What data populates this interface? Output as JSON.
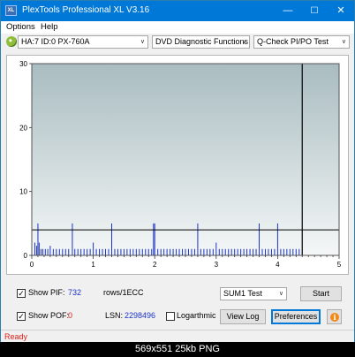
{
  "window": {
    "title": "PlexTools Professional XL V3.16",
    "logo_text": "XL",
    "minimize_glyph": "—",
    "maximize_glyph": "☐",
    "close_glyph": "✕"
  },
  "menu": {
    "options": "Options",
    "help": "Help"
  },
  "toolbar": {
    "drive": "HA:7 ID:0  PX-760A",
    "function": "DVD Diagnostic Functions",
    "test": "Q-Check PI/PO Test",
    "dropdown_glyph": "∨"
  },
  "controls": {
    "show_pif_label": "Show PIF:",
    "pif_value": "732",
    "rows_label": "rows/1ECC",
    "show_pof_label": "Show POF:",
    "pof_value": "0",
    "lsn_label": "LSN:",
    "lsn_value": "2298496",
    "logarithmic_label": "Logarthmic",
    "sum_select": "SUM1 Test",
    "start_label": "Start",
    "view_log_label": "View Log",
    "preferences_label": "Preferences",
    "info_glyph": "i",
    "check_glyph": "✓"
  },
  "status": {
    "text": "Ready"
  },
  "caption": {
    "text": "569x551  25kb  PNG"
  },
  "colors": {
    "title_bar": "#0078d7",
    "plot_top": "#a9bcc0",
    "plot_bottom": "#f4f7f7",
    "series": "#1c33c8",
    "threshold": "#000000",
    "status": "#e0201c"
  },
  "chart_data": {
    "type": "bar",
    "title": "",
    "xlabel": "",
    "ylabel": "",
    "xlim": [
      0,
      5
    ],
    "ylim": [
      0,
      30
    ],
    "x_ticks": [
      0,
      1,
      2,
      3,
      4,
      5
    ],
    "y_ticks": [
      0,
      10,
      20,
      30
    ],
    "x_minor_step": 0.1,
    "grid": false,
    "threshold_y": 4,
    "end_marker_x": 4.4,
    "series": [
      {
        "x": [
          0.05,
          0.08,
          0.1,
          0.12,
          0.15,
          0.18,
          0.22,
          0.26,
          0.3,
          0.35,
          0.4,
          0.45,
          0.5,
          0.55,
          0.6,
          0.66,
          0.7,
          0.75,
          0.8,
          0.85,
          0.9,
          0.95,
          1.0,
          1.05,
          1.1,
          1.15,
          1.2,
          1.25,
          1.3,
          1.35,
          1.4,
          1.45,
          1.5,
          1.55,
          1.6,
          1.65,
          1.7,
          1.75,
          1.8,
          1.85,
          1.9,
          1.95,
          1.98,
          2.0,
          2.05,
          2.1,
          2.15,
          2.2,
          2.25,
          2.3,
          2.35,
          2.4,
          2.45,
          2.5,
          2.55,
          2.6,
          2.65,
          2.7,
          2.75,
          2.8,
          2.85,
          2.9,
          2.95,
          3.0,
          3.05,
          3.1,
          3.15,
          3.2,
          3.25,
          3.3,
          3.35,
          3.4,
          3.45,
          3.5,
          3.55,
          3.6,
          3.65,
          3.7,
          3.75,
          3.8,
          3.85,
          3.9,
          3.95,
          4.0,
          4.05,
          4.1,
          4.15,
          4.2,
          4.25,
          4.3,
          4.35
        ],
        "values": [
          2,
          1.5,
          5,
          2,
          1,
          1,
          1,
          1,
          1.5,
          1,
          1,
          1,
          1,
          1,
          1,
          5,
          1,
          1,
          1,
          1,
          1,
          1,
          2,
          1,
          1,
          1,
          1,
          1,
          5,
          1,
          1,
          1,
          1,
          1,
          1,
          1,
          1,
          1,
          1,
          1,
          1,
          1,
          5,
          5,
          1,
          1,
          1,
          1,
          1,
          1,
          1,
          1,
          1,
          1,
          1,
          1,
          1,
          5,
          1,
          1,
          1,
          1,
          1,
          2,
          1,
          1,
          1,
          1,
          1,
          1,
          1,
          1,
          1,
          1,
          1,
          1,
          1,
          5,
          1,
          1,
          1,
          1,
          1,
          5,
          1,
          1,
          1,
          1,
          1,
          1,
          1
        ]
      }
    ]
  }
}
